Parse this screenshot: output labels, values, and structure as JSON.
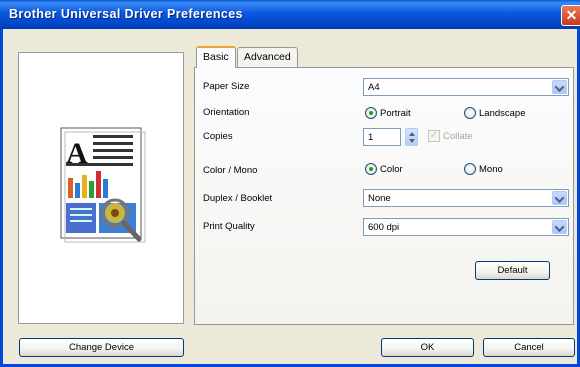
{
  "window": {
    "title": "Brother Universal Driver Preferences",
    "close_symbol": "✕"
  },
  "tabs": [
    {
      "label": "Basic"
    },
    {
      "label": "Advanced"
    }
  ],
  "basic": {
    "paper_size": {
      "label": "Paper Size",
      "value": "A4"
    },
    "orientation": {
      "label": "Orientation",
      "portrait": "Portrait",
      "landscape": "Landscape",
      "selected": "Portrait"
    },
    "copies": {
      "label": "Copies",
      "value": "1",
      "collate": "Collate"
    },
    "color_mono": {
      "label": "Color / Mono",
      "color": "Color",
      "mono": "Mono",
      "selected": "Color"
    },
    "duplex_booklet": {
      "label": "Duplex / Booklet",
      "value": "None"
    },
    "print_quality": {
      "label": "Print Quality",
      "value": "600 dpi"
    },
    "default_button": "Default"
  },
  "footer": {
    "change_device": "Change Device",
    "ok": "OK",
    "cancel": "Cancel"
  },
  "preview": {
    "glyph": "A"
  },
  "colors": {
    "title_bar": "#0a58e0",
    "dialog_bg": "#ece9d8",
    "selected_tab_accent": "#e8a33a"
  }
}
